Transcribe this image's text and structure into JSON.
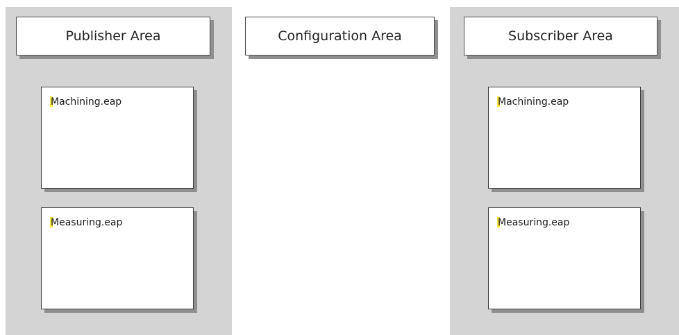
{
  "areas": {
    "publisher": {
      "title": "Publisher Area",
      "packages": [
        {
          "name": "Machining.eap"
        },
        {
          "name": "Measuring.eap"
        }
      ]
    },
    "configuration": {
      "title": "Configuration Area"
    },
    "subscriber": {
      "title": "Subscriber Area",
      "packages": [
        {
          "name": "Machining.eap"
        },
        {
          "name": "Measuring.eap"
        }
      ]
    }
  },
  "colors": {
    "lane_background": "#d4d4d4",
    "box_background": "#ffffff",
    "box_shadow": "#8f8f8f",
    "package_marker": "#f5e642"
  }
}
